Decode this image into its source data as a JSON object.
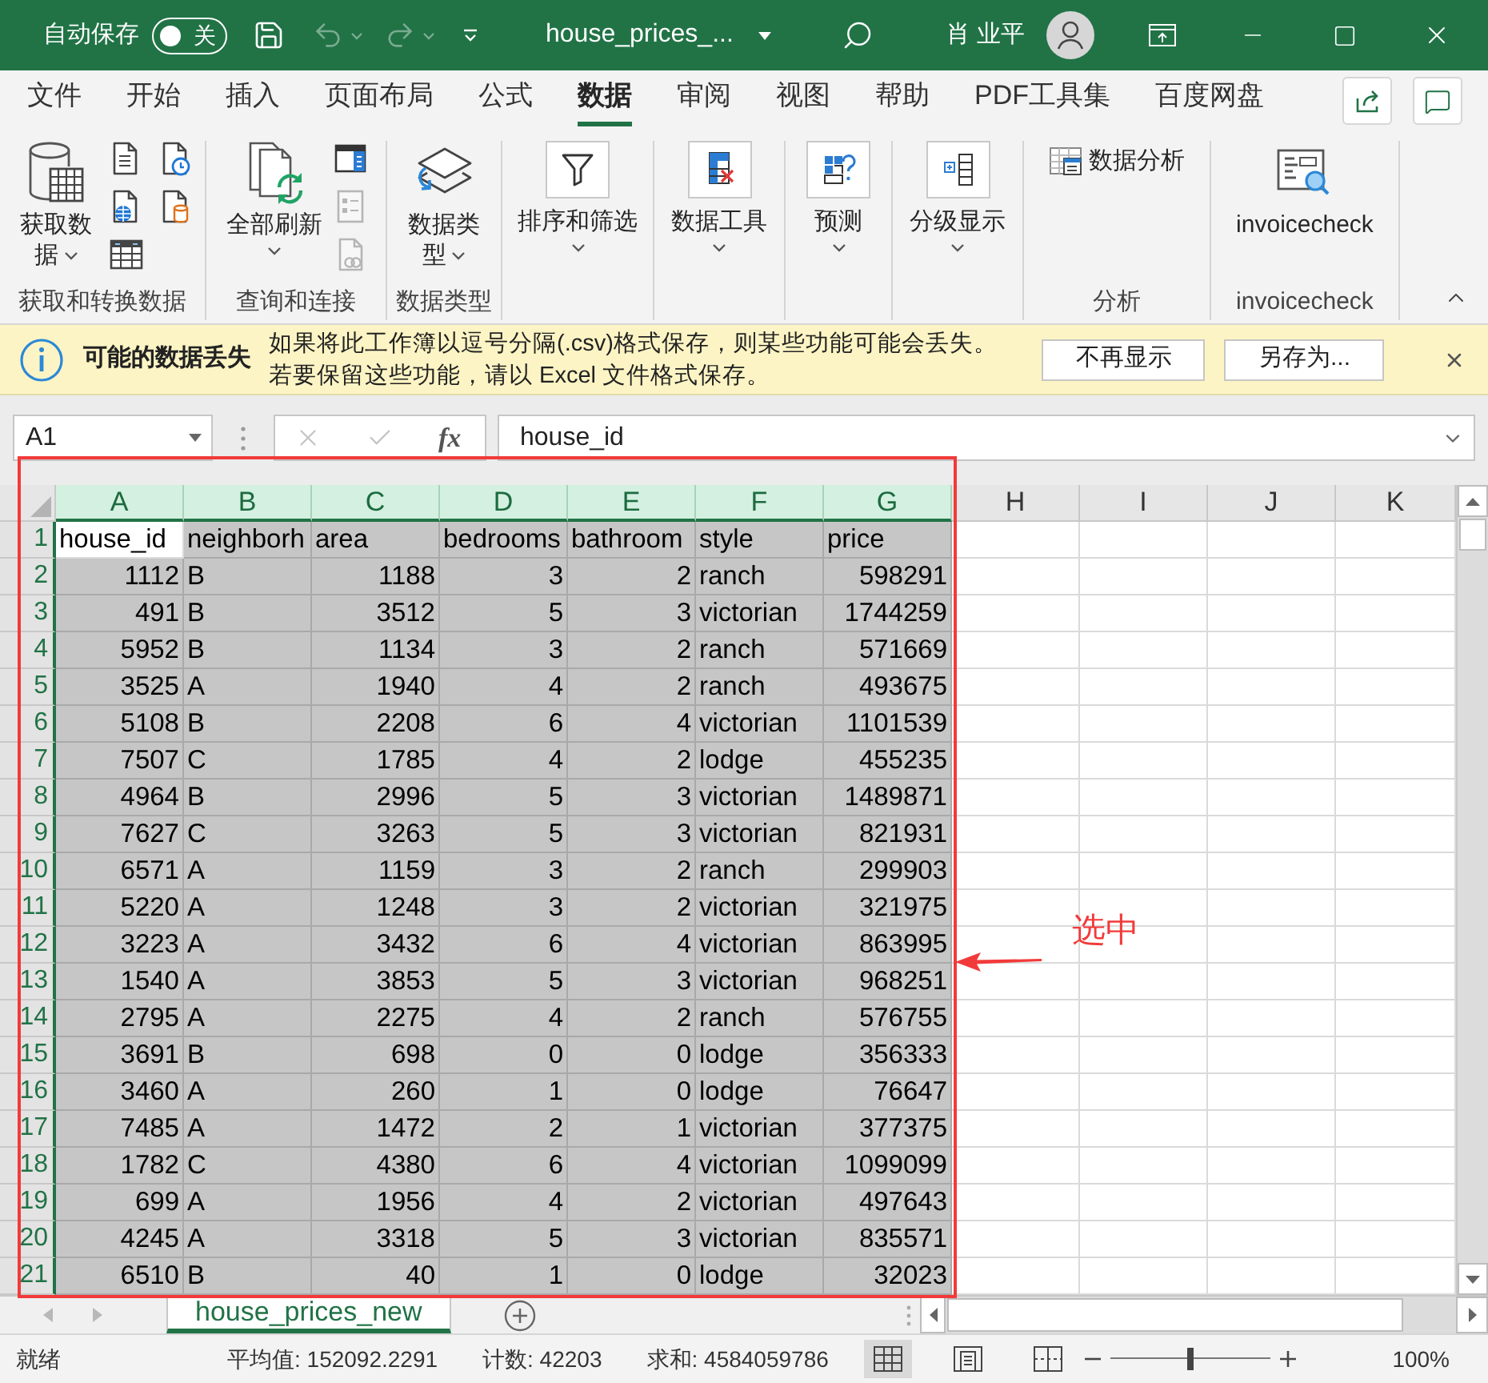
{
  "title_bar": {
    "autosave_label": "自动保存",
    "autosave_on": false,
    "autosave_state": "关",
    "file_name": "house_prices_...",
    "user_name": "肖 业平"
  },
  "quick_access": [
    {
      "disabled": false
    },
    {
      "disabled": true
    },
    {
      "disabled": true
    }
  ],
  "ribbon_tabs": [
    {
      "label": "文件",
      "selected": false
    },
    {
      "label": "开始",
      "selected": false
    },
    {
      "label": "插入",
      "selected": false
    },
    {
      "label": "页面布局",
      "selected": false
    },
    {
      "label": "公式",
      "selected": false
    },
    {
      "label": "数据",
      "selected": true
    },
    {
      "label": "审阅",
      "selected": false
    },
    {
      "label": "视图",
      "selected": false
    },
    {
      "label": "帮助",
      "selected": false
    },
    {
      "label": "PDF工具集",
      "selected": false
    },
    {
      "label": "百度网盘",
      "selected": false
    }
  ],
  "ribbon_groups": [
    {
      "kind": "full",
      "label": "获取和转换数据",
      "large": [
        {
          "label": "获取数据",
          "kind": "wrap",
          "menu": true
        }
      ],
      "small_buttons": [
        {
          "disabled": false
        },
        {
          "disabled": false
        },
        {
          "disabled": false
        },
        {
          "disabled": false
        },
        {
          "disabled": false
        }
      ]
    },
    {
      "kind": "full",
      "label": "查询和连接",
      "large": [
        {
          "label": "全部刷新",
          "kind": "stack",
          "menu": true
        }
      ],
      "small_buttons": [
        {
          "disabled": false
        },
        {
          "disabled": true
        },
        {
          "disabled": true
        }
      ]
    },
    {
      "kind": "full",
      "label": "数据类型",
      "large": [
        {
          "label": "数据类型",
          "kind": "wrap",
          "menu": true
        }
      ]
    },
    {
      "kind": "collapsed",
      "large": [
        {
          "label": "排序和筛选",
          "kind": "stack",
          "menu": true
        }
      ]
    },
    {
      "kind": "collapsed",
      "large": [
        {
          "label": "数据工具",
          "kind": "stack",
          "menu": true
        }
      ]
    },
    {
      "kind": "collapsed",
      "large": [
        {
          "label": "预测",
          "kind": "stack",
          "menu": true
        }
      ]
    },
    {
      "kind": "collapsed",
      "large": [
        {
          "label": "分级显示",
          "kind": "stack",
          "menu": true
        }
      ]
    },
    {
      "kind": "full",
      "label": "分析",
      "small_buttons": [
        {
          "label": "数据分析",
          "disabled": false
        }
      ]
    },
    {
      "kind": "full",
      "label": "invoicecheck",
      "large": [
        {
          "label": "invoicecheck",
          "kind": "stack",
          "menu": false
        }
      ]
    }
  ],
  "info_bar": {
    "title": "可能的数据丢失",
    "message_lines": [
      "如果将此工作簿以逗号分隔(.csv)格式保存，则某些功能可能会丢失。",
      "若要保留这些功能，请以 Excel 文件格式保存。"
    ],
    "buttons": [
      "不再显示",
      "另存为..."
    ]
  },
  "formula_bar": {
    "name_box": "A1",
    "edit_buttons": [
      {
        "disabled": true
      },
      {
        "disabled": true
      }
    ],
    "function_label": "fx",
    "formula": "house_id"
  },
  "sheet": {
    "columns": [
      {
        "letter": "A",
        "selected": true,
        "kind": "number"
      },
      {
        "letter": "B",
        "selected": true,
        "kind": "text"
      },
      {
        "letter": "C",
        "selected": true,
        "kind": "number"
      },
      {
        "letter": "D",
        "selected": true,
        "kind": "number"
      },
      {
        "letter": "E",
        "selected": true,
        "kind": "number"
      },
      {
        "letter": "F",
        "selected": true,
        "kind": "text"
      },
      {
        "letter": "G",
        "selected": true,
        "kind": "number"
      },
      {
        "letter": "H",
        "selected": false
      },
      {
        "letter": "I",
        "selected": false
      },
      {
        "letter": "J",
        "selected": false
      },
      {
        "letter": "K",
        "selected": false
      }
    ],
    "header_row": {
      "number": "1",
      "selected": true,
      "cells": [
        {
          "text": "house_id",
          "active": true
        },
        {
          "text": "neighborh",
          "active": false
        },
        {
          "text": "area",
          "active": false
        },
        {
          "text": "bedrooms",
          "active": false
        },
        {
          "text": "bathroom",
          "active": false
        },
        {
          "text": "style",
          "active": false
        },
        {
          "text": "price",
          "active": false
        }
      ]
    },
    "rows": [
      {
        "number": "2",
        "selected": true,
        "cells": [
          "1112",
          "B",
          "1188",
          "3",
          "2",
          "ranch",
          "598291"
        ]
      },
      {
        "number": "3",
        "selected": true,
        "cells": [
          "491",
          "B",
          "3512",
          "5",
          "3",
          "victorian",
          "1744259"
        ]
      },
      {
        "number": "4",
        "selected": true,
        "cells": [
          "5952",
          "B",
          "1134",
          "3",
          "2",
          "ranch",
          "571669"
        ]
      },
      {
        "number": "5",
        "selected": true,
        "cells": [
          "3525",
          "A",
          "1940",
          "4",
          "2",
          "ranch",
          "493675"
        ]
      },
      {
        "number": "6",
        "selected": true,
        "cells": [
          "5108",
          "B",
          "2208",
          "6",
          "4",
          "victorian",
          "1101539"
        ]
      },
      {
        "number": "7",
        "selected": true,
        "cells": [
          "7507",
          "C",
          "1785",
          "4",
          "2",
          "lodge",
          "455235"
        ]
      },
      {
        "number": "8",
        "selected": true,
        "cells": [
          "4964",
          "B",
          "2996",
          "5",
          "3",
          "victorian",
          "1489871"
        ]
      },
      {
        "number": "9",
        "selected": true,
        "cells": [
          "7627",
          "C",
          "3263",
          "5",
          "3",
          "victorian",
          "821931"
        ]
      },
      {
        "number": "10",
        "selected": true,
        "cells": [
          "6571",
          "A",
          "1159",
          "3",
          "2",
          "ranch",
          "299903"
        ]
      },
      {
        "number": "11",
        "selected": true,
        "cells": [
          "5220",
          "A",
          "1248",
          "3",
          "2",
          "victorian",
          "321975"
        ]
      },
      {
        "number": "12",
        "selected": true,
        "cells": [
          "3223",
          "A",
          "3432",
          "6",
          "4",
          "victorian",
          "863995"
        ]
      },
      {
        "number": "13",
        "selected": true,
        "cells": [
          "1540",
          "A",
          "3853",
          "5",
          "3",
          "victorian",
          "968251"
        ]
      },
      {
        "number": "14",
        "selected": true,
        "cells": [
          "2795",
          "A",
          "2275",
          "4",
          "2",
          "ranch",
          "576755"
        ]
      },
      {
        "number": "15",
        "selected": true,
        "cells": [
          "3691",
          "B",
          "698",
          "0",
          "0",
          "lodge",
          "356333"
        ]
      },
      {
        "number": "16",
        "selected": true,
        "cells": [
          "3460",
          "A",
          "260",
          "1",
          "0",
          "lodge",
          "76647"
        ]
      },
      {
        "number": "17",
        "selected": true,
        "cells": [
          "7485",
          "A",
          "1472",
          "2",
          "1",
          "victorian",
          "377375"
        ]
      },
      {
        "number": "18",
        "selected": true,
        "cells": [
          "1782",
          "C",
          "4380",
          "6",
          "4",
          "victorian",
          "1099099"
        ]
      },
      {
        "number": "19",
        "selected": true,
        "cells": [
          "699",
          "A",
          "1956",
          "4",
          "2",
          "victorian",
          "497643"
        ]
      },
      {
        "number": "20",
        "selected": true,
        "cells": [
          "4245",
          "A",
          "3318",
          "5",
          "3",
          "victorian",
          "835571"
        ]
      },
      {
        "number": "21",
        "selected": true,
        "cells": [
          "6510",
          "B",
          "40",
          "1",
          "0",
          "lodge",
          "32023"
        ]
      }
    ]
  },
  "sheet_tabs": [
    {
      "label": "house_prices_new",
      "selected": true
    }
  ],
  "status_bar": {
    "mode": "就绪",
    "stats": [
      "平均值: 152092.2291",
      "计数: 42203",
      "求和: 4584059786"
    ],
    "views": [
      {
        "selected": true
      },
      {
        "selected": false
      },
      {
        "selected": false
      }
    ],
    "zoom_slider": {
      "level": 0.5
    },
    "zoom": "100%"
  },
  "annotation": {
    "label": "选中"
  }
}
